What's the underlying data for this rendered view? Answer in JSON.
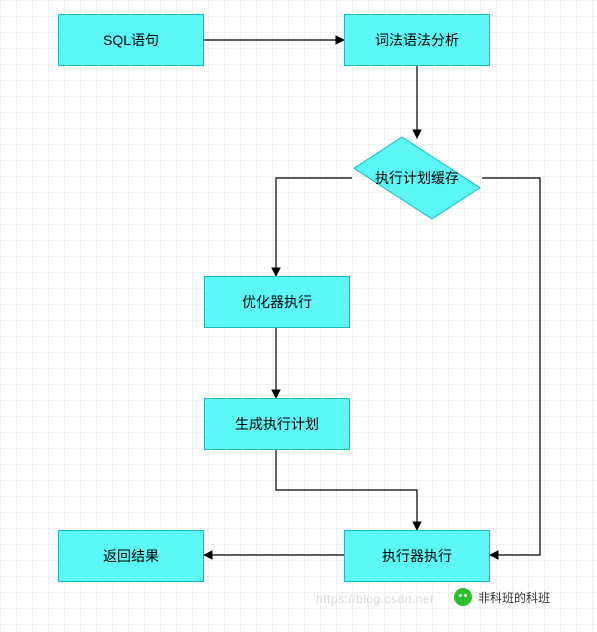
{
  "chart_data": {
    "type": "diagram",
    "title": "",
    "nodes": [
      {
        "id": "sql",
        "shape": "rect",
        "label": "SQL语句"
      },
      {
        "id": "lexer",
        "shape": "rect",
        "label": "词法语法分析"
      },
      {
        "id": "cache",
        "shape": "diamond",
        "label": "执行计划缓存"
      },
      {
        "id": "optimize",
        "shape": "rect",
        "label": "优化器执行"
      },
      {
        "id": "genplan",
        "shape": "rect",
        "label": "生成执行计划"
      },
      {
        "id": "execute",
        "shape": "rect",
        "label": "执行器执行"
      },
      {
        "id": "result",
        "shape": "rect",
        "label": "返回结果"
      }
    ],
    "edges": [
      {
        "from": "sql",
        "to": "lexer"
      },
      {
        "from": "lexer",
        "to": "cache"
      },
      {
        "from": "cache",
        "to": "optimize"
      },
      {
        "from": "cache",
        "to": "execute"
      },
      {
        "from": "optimize",
        "to": "genplan"
      },
      {
        "from": "genplan",
        "to": "execute"
      },
      {
        "from": "execute",
        "to": "result"
      }
    ]
  },
  "colors": {
    "node_fill": "#5cf8f8",
    "node_stroke": "#17b9b9",
    "edge": "#000000",
    "grid": "#f0f0f0"
  },
  "watermark": {
    "url_text": "https://blog.csdn.net",
    "brand_text": "非科班的科班"
  }
}
